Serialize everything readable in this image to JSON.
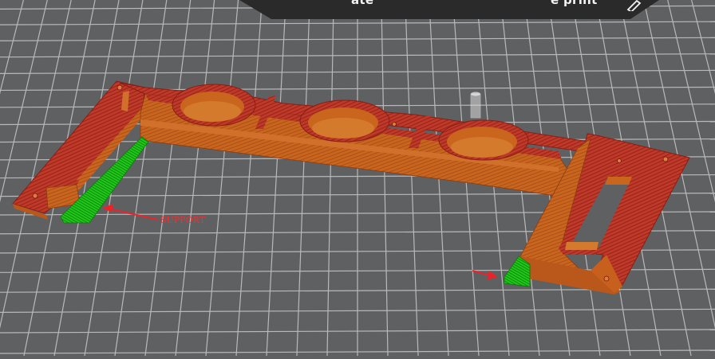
{
  "top_bar": {
    "left_label_fragment": "ate",
    "right_label_fragment": "e print",
    "edit_icon": "pencil-icon"
  },
  "annotations": {
    "support_label": "SUPPORT",
    "arrow_color": "#e8242a"
  },
  "colors": {
    "background": "#5f6062",
    "grid": "#b8b8b8",
    "model_top": "#c0362c",
    "model_side": "#c8641c",
    "support": "#22c81a",
    "top_banner": "#2b2b2b"
  }
}
